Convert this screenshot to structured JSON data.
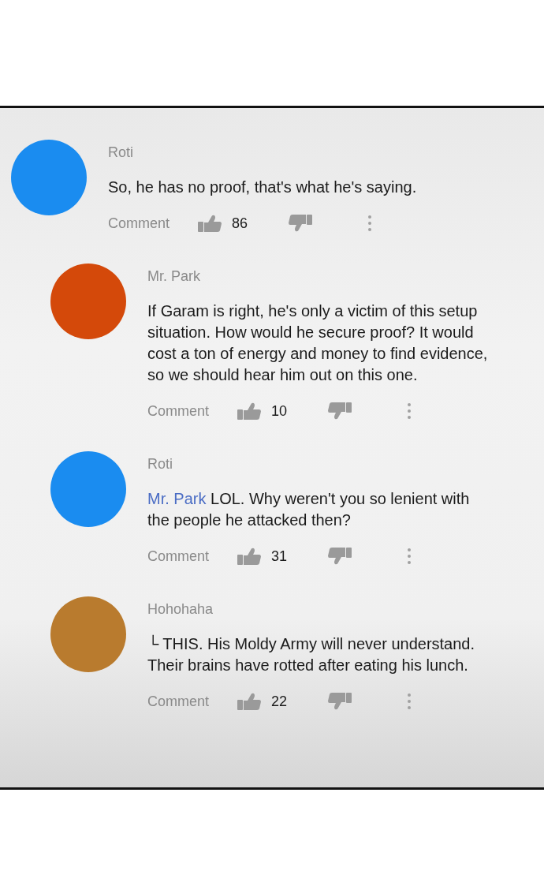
{
  "comments": [
    {
      "author": "Roti",
      "color": "#1a8cf0",
      "text": "So, he has no proof, that's what he's saying.",
      "action_label": "Comment",
      "likes": "86",
      "children": [
        {
          "author": "Mr. Park",
          "color": "#d4490a",
          "text": "If Garam is right, he's only a victim of this setup situation. How would he secure proof? It would cost a ton of energy and money to find evidence, so we should hear him out on this one.",
          "action_label": "Comment",
          "likes": "10"
        },
        {
          "author": "Roti",
          "color": "#1a8cf0",
          "mention": "Mr. Park",
          "text": "LOL. Why weren't you so lenient with the people he attacked then?",
          "action_label": "Comment",
          "likes": "31"
        },
        {
          "author": "Hohohaha",
          "color": "#b97b2e",
          "text": "└ THIS. His Moldy Army will never understand. Their brains have rotted after eating his lunch.",
          "action_label": "Comment",
          "likes": "22"
        }
      ]
    }
  ]
}
